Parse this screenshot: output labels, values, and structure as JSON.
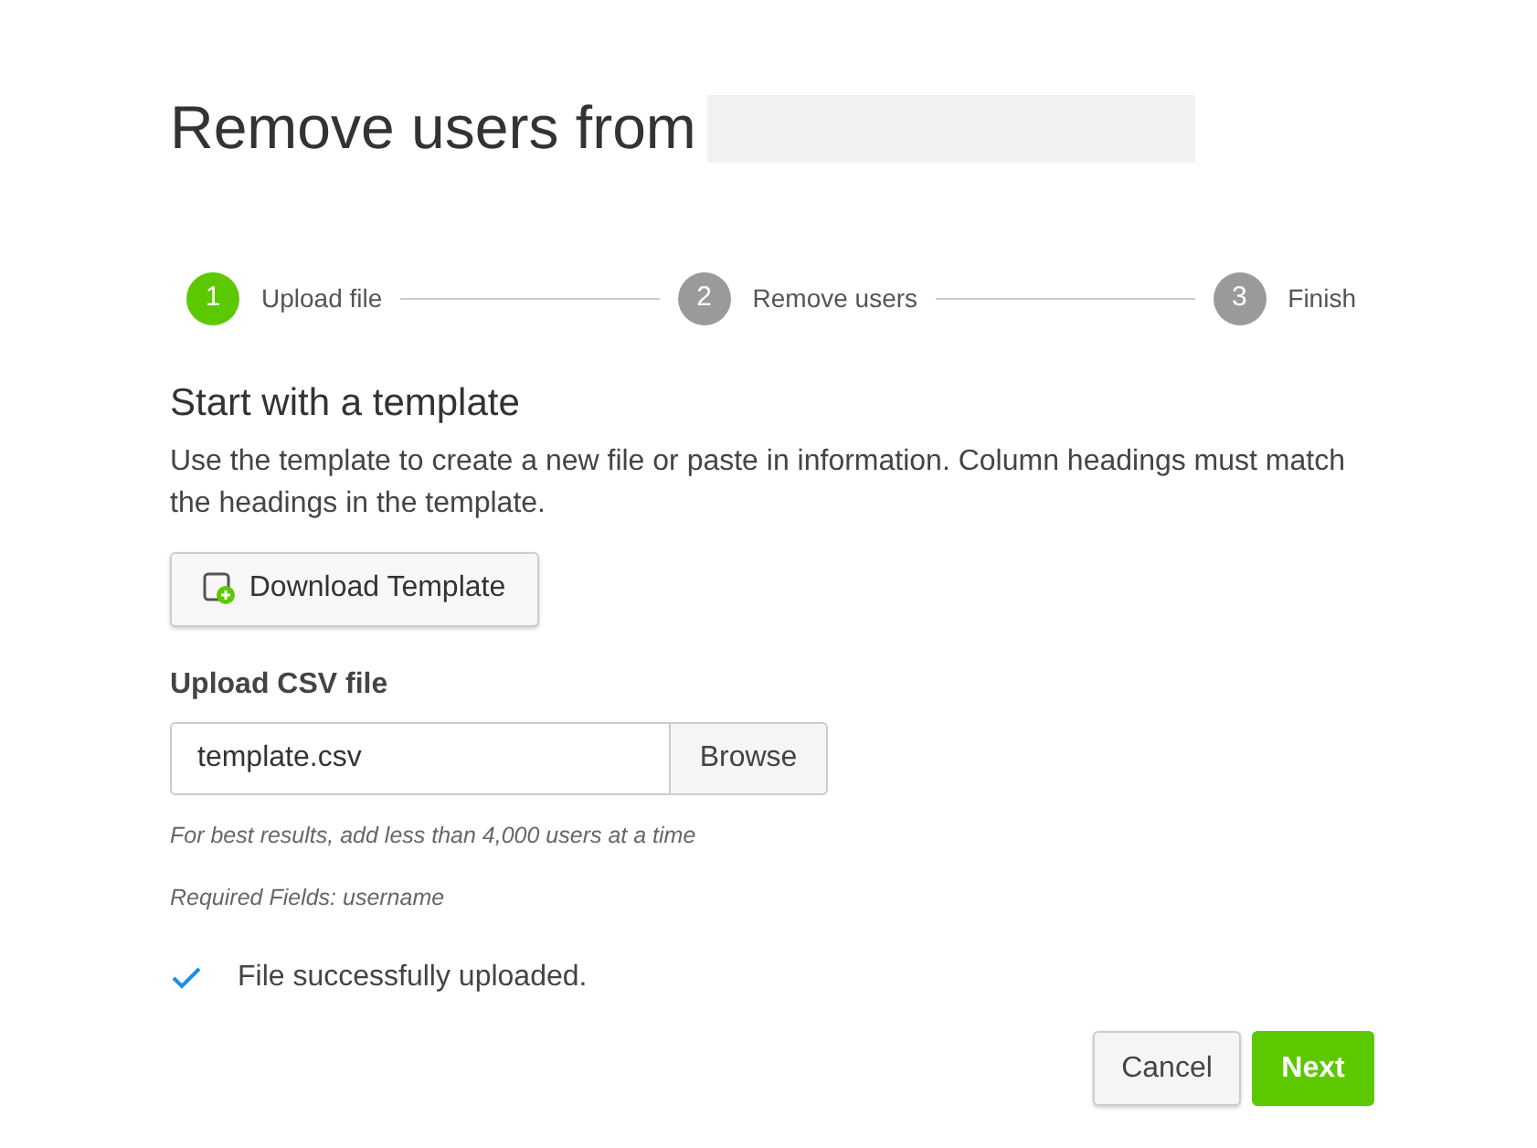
{
  "title": "Remove users from",
  "steps": [
    {
      "number": "1",
      "label": "Upload file",
      "selected": true
    },
    {
      "number": "2",
      "label": "Remove users",
      "selected": false
    },
    {
      "number": "3",
      "label": "Finish",
      "selected": false
    }
  ],
  "template_section": {
    "heading": "Start with a template",
    "description": "Use the template to create a new file or paste in information. Column headings must match the headings in the template.",
    "button": "Download Template"
  },
  "upload": {
    "label": "Upload CSV file",
    "value": "template.csv",
    "browse_button": "Browse",
    "hints": [
      "For best results, add less than 4,000 users at a time",
      "Required Fields: username"
    ]
  },
  "status": {
    "message": "File successfully uploaded.",
    "success": true
  },
  "buttons": {
    "cancel": "Cancel",
    "next": "Next"
  }
}
